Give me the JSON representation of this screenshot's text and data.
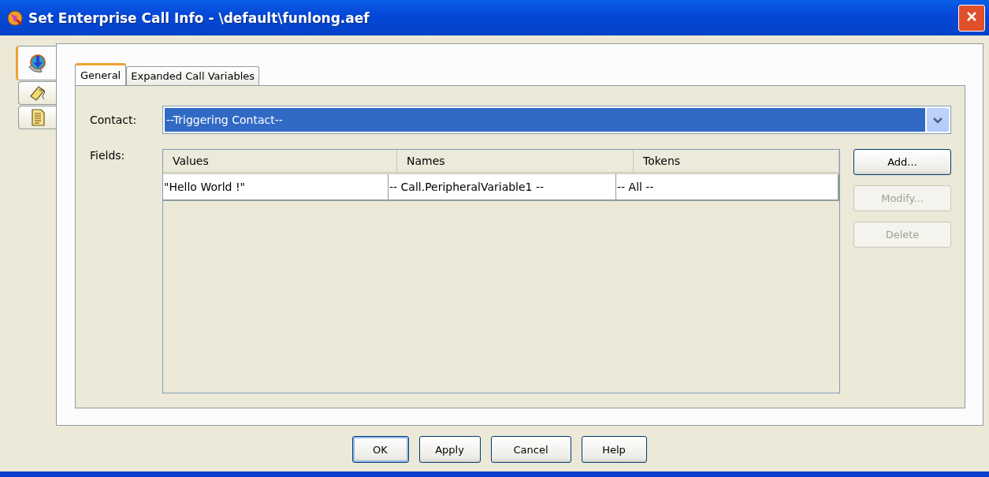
{
  "window": {
    "title": "Set Enterprise Call Info - \\default\\funlong.aef"
  },
  "side_tabs": [
    {
      "kind": "phone",
      "selected": true
    },
    {
      "kind": "tag",
      "selected": false
    },
    {
      "kind": "document",
      "selected": false
    }
  ],
  "tabs": [
    {
      "label": "General",
      "selected": true
    },
    {
      "label": "Expanded Call Variables",
      "selected": false
    }
  ],
  "contact": {
    "label": "Contact:",
    "value": "--Triggering Contact--"
  },
  "fields": {
    "label": "Fields:",
    "columns": [
      "Values",
      "Names",
      "Tokens"
    ],
    "rows": [
      {
        "cells": [
          "\"Hello World !\"",
          "-- Call.PeripheralVariable1 --",
          "-- All --"
        ]
      }
    ]
  },
  "side_buttons": [
    {
      "label": "Add...",
      "disabled": false
    },
    {
      "label": "Modify...",
      "disabled": true
    },
    {
      "label": "Delete",
      "disabled": true
    }
  ],
  "buttons": [
    {
      "label": "OK",
      "focused": true
    },
    {
      "label": "Apply",
      "focused": false
    },
    {
      "label": "Cancel",
      "focused": false
    },
    {
      "label": "Help",
      "focused": false
    }
  ]
}
